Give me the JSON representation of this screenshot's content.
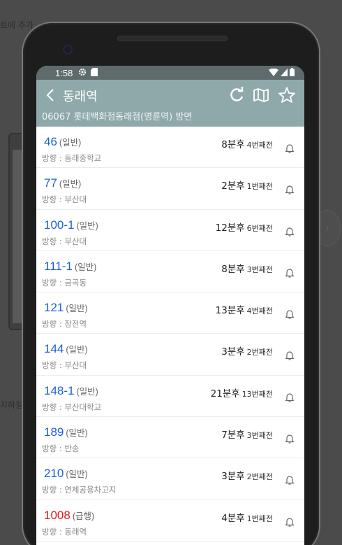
{
  "background": {
    "top_text": "트에 추가",
    "left_text": "지하철"
  },
  "statusbar": {
    "time": "1:58",
    "icons": [
      "gear-icon",
      "sim-icon",
      "wifi-icon",
      "signal-icon",
      "battery-icon"
    ]
  },
  "header": {
    "title": "동래역",
    "subtitle": "06067 롯데백화점동래점(명륜역) 방면",
    "icons": [
      "back-icon",
      "refresh-icon",
      "map-icon",
      "star-icon"
    ]
  },
  "colors": {
    "header_bg": "#8fa9aa",
    "route_normal": "#1a5fd6",
    "route_express": "#e01919"
  },
  "arrivals": [
    {
      "route": "46",
      "type": "(일반)",
      "direction": "방향 : 동래중학교",
      "minutes": "8분후",
      "stops": "4번째전",
      "express": false
    },
    {
      "route": "77",
      "type": "(일반)",
      "direction": "방향 : 부산대",
      "minutes": "2분후",
      "stops": "1번째전",
      "express": false
    },
    {
      "route": "100-1",
      "type": "(일반)",
      "direction": "방향 : 부산대",
      "minutes": "12분후",
      "stops": "6번째전",
      "express": false
    },
    {
      "route": "111-1",
      "type": "(일반)",
      "direction": "방향 : 금곡동",
      "minutes": "8분후",
      "stops": "3번째전",
      "express": false
    },
    {
      "route": "121",
      "type": "(일반)",
      "direction": "방향 : 장전역",
      "minutes": "13분후",
      "stops": "4번째전",
      "express": false
    },
    {
      "route": "144",
      "type": "(일반)",
      "direction": "방향 : 부산대",
      "minutes": "3분후",
      "stops": "2번째전",
      "express": false
    },
    {
      "route": "148-1",
      "type": "(일반)",
      "direction": "방향 : 부산대학교",
      "minutes": "21분후",
      "stops": "13번째전",
      "express": false
    },
    {
      "route": "189",
      "type": "(일반)",
      "direction": "방향 : 반송",
      "minutes": "7분후",
      "stops": "3번째전",
      "express": false
    },
    {
      "route": "210",
      "type": "(일반)",
      "direction": "방향 : 연제공용차고지",
      "minutes": "3분후",
      "stops": "2번째전",
      "express": false
    },
    {
      "route": "1008",
      "type": "(급행)",
      "direction": "방향 : 동래역",
      "minutes": "4분후",
      "stops": "1번째전",
      "express": true
    }
  ]
}
